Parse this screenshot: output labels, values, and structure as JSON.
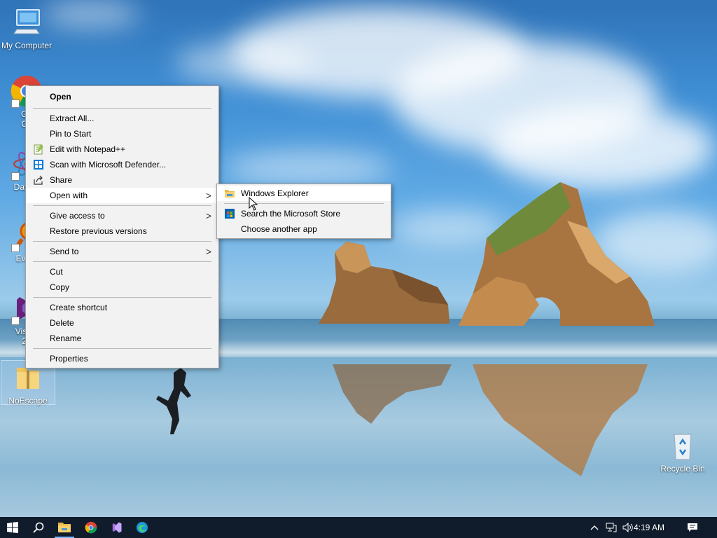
{
  "desktop": {
    "icons": {
      "my_computer": "My Computer",
      "chrome_partial_1": "Go",
      "chrome_partial_2": "Ch",
      "datawrapper_partial": "DataW",
      "everything_partial": "Every",
      "visual_partial_1": "Visual",
      "visual_partial_2": "20",
      "noescape": "NoEscape",
      "recycle_bin": "Recycle Bin"
    }
  },
  "context_menu": {
    "items": [
      {
        "label": "Open"
      },
      {
        "label": "Extract All..."
      },
      {
        "label": "Pin to Start"
      },
      {
        "label": "Edit with Notepad++"
      },
      {
        "label": "Scan with Microsoft Defender..."
      },
      {
        "label": "Share"
      },
      {
        "label": "Open with"
      },
      {
        "label": "Give access to"
      },
      {
        "label": "Restore previous versions"
      },
      {
        "label": "Send to"
      },
      {
        "label": "Cut"
      },
      {
        "label": "Copy"
      },
      {
        "label": "Create shortcut"
      },
      {
        "label": "Delete"
      },
      {
        "label": "Rename"
      },
      {
        "label": "Properties"
      }
    ],
    "arrow_glyph": ">"
  },
  "submenu": {
    "items": [
      {
        "label": "Windows Explorer"
      },
      {
        "label": "Search the Microsoft Store"
      },
      {
        "label": "Choose another app"
      }
    ]
  },
  "taskbar": {
    "clock": "4:19 AM"
  },
  "colors": {
    "taskbar_bg": "#101c2c",
    "menu_bg": "#f2f2f2",
    "accent": "#0078d7"
  }
}
